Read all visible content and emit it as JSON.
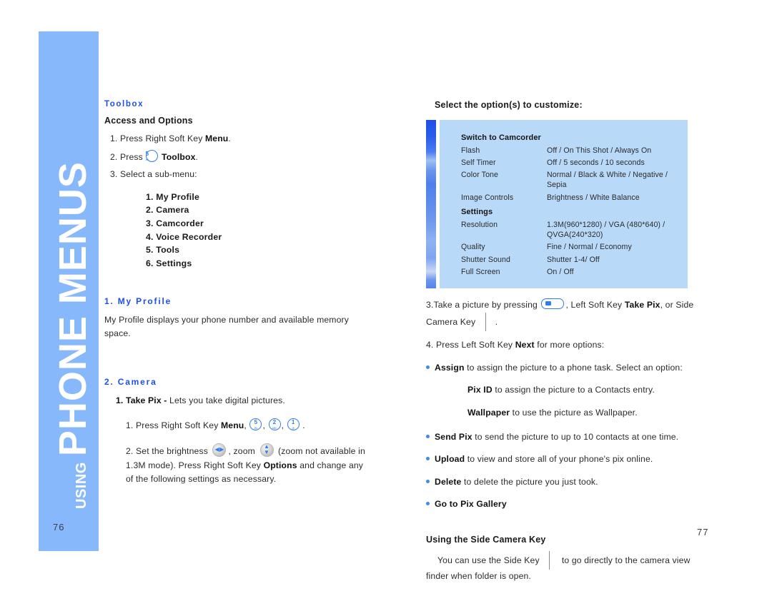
{
  "document": {
    "sidebar": {
      "using_label": "USING",
      "title": "PHONE MENUS",
      "background_color": "#86b8fb"
    },
    "page_number_left": "76",
    "page_number_right": "77"
  },
  "left_column": {
    "section_heading": "Toolbox",
    "subheading": "Access and Options",
    "steps": {
      "step1_pre": "1. Press Right Soft Key ",
      "step1_bold": "Menu",
      "step1_post": ".",
      "step2_pre": "2. Press ",
      "step2_key_num": "5",
      "step2_key_sub": "JKL",
      "step2_bold": "Toolbox",
      "step2_post": ".",
      "step3": "3. Select a sub-menu:"
    },
    "submenu": [
      "1. My Profile",
      "2. Camera",
      "3. Camcorder",
      "4. Voice Recorder",
      "5. Tools",
      "6. Settings"
    ],
    "my_profile": {
      "heading": "1. My Profile",
      "body": "My Profile displays your phone number and available memory space."
    },
    "camera": {
      "heading": "2. Camera",
      "take_pix_bold": "1. Take Pix -",
      "take_pix_rest": " Lets you take digital pictures.",
      "step1_pre": "1. Press Right Soft Key ",
      "step1_bold": "Menu",
      "step1_mid": ", ",
      "keys": [
        {
          "num": "5",
          "sub": "JKL"
        },
        {
          "num": "2",
          "sub": "ABC"
        },
        {
          "num": "1",
          "sub": "@"
        }
      ],
      "step1_post": ".",
      "step2_a": "2. Set the brightness ",
      "step2_b": ", zoom ",
      "step2_c": " (zoom not available in 1.3M mode). Press Right Soft Key ",
      "step2_bold": "Options",
      "step2_d": " and change any of the following settings as necessary."
    }
  },
  "right_column": {
    "table_intro": "Select the option(s) to customize:",
    "options_table": {
      "rows": [
        {
          "type": "group",
          "label": "Switch to Camcorder",
          "value": ""
        },
        {
          "type": "row",
          "label": "Flash",
          "value": "Off / On This Shot / Always On"
        },
        {
          "type": "row",
          "label": "Self Timer",
          "value": "Off / 5 seconds / 10 seconds"
        },
        {
          "type": "row",
          "label": "Color Tone",
          "value": "Normal / Black & White / Negative / Sepia"
        },
        {
          "type": "row",
          "label": "Image Controls",
          "value": "Brightness / White Balance"
        },
        {
          "type": "group",
          "label": "Settings",
          "value": ""
        },
        {
          "type": "row",
          "label": "Resolution",
          "value": "1.3M(960*1280) / VGA (480*640) / QVGA(240*320)"
        },
        {
          "type": "row",
          "label": "Quality",
          "value": "Fine / Normal / Economy"
        },
        {
          "type": "row",
          "label": "Shutter Sound",
          "value": "Shutter 1-4/ Off"
        },
        {
          "type": "row",
          "label": "Full Screen",
          "value": "On / Off"
        }
      ]
    },
    "step3_a": "3.Take a picture by pressing ",
    "step3_b": ", Left Soft Key ",
    "step3_bold": "Take Pix",
    "step3_c": ", or Side Camera Key ",
    "step3_d": ".",
    "step4_a": "4. Press Left Soft Key ",
    "step4_bold": "Next",
    "step4_b": " for more options:",
    "bullets": [
      {
        "bold": "Assign",
        "text": " to assign the picture to a phone task. Select an option:"
      },
      {
        "bold": "Send Pix",
        "text": " to send the picture to up to 10 contacts at one time."
      },
      {
        "bold": "Upload",
        "text": " to view and store all of your phone's pix online."
      },
      {
        "bold": "Delete",
        "text": " to delete the picture you just took."
      },
      {
        "bold": "Go to Pix Gallery",
        "text": ""
      }
    ],
    "assign_subitems": [
      {
        "bold": "Pix ID",
        "text": " to assign the picture to a Contacts entry."
      },
      {
        "bold": "Wallpaper",
        "text": " to use the picture as Wallpaper."
      }
    ],
    "side_key_heading": "Using the Side Camera Key",
    "side_key_body_a": "You can use the Side Key ",
    "side_key_body_b": " to go directly to the camera view finder when folder is open."
  }
}
